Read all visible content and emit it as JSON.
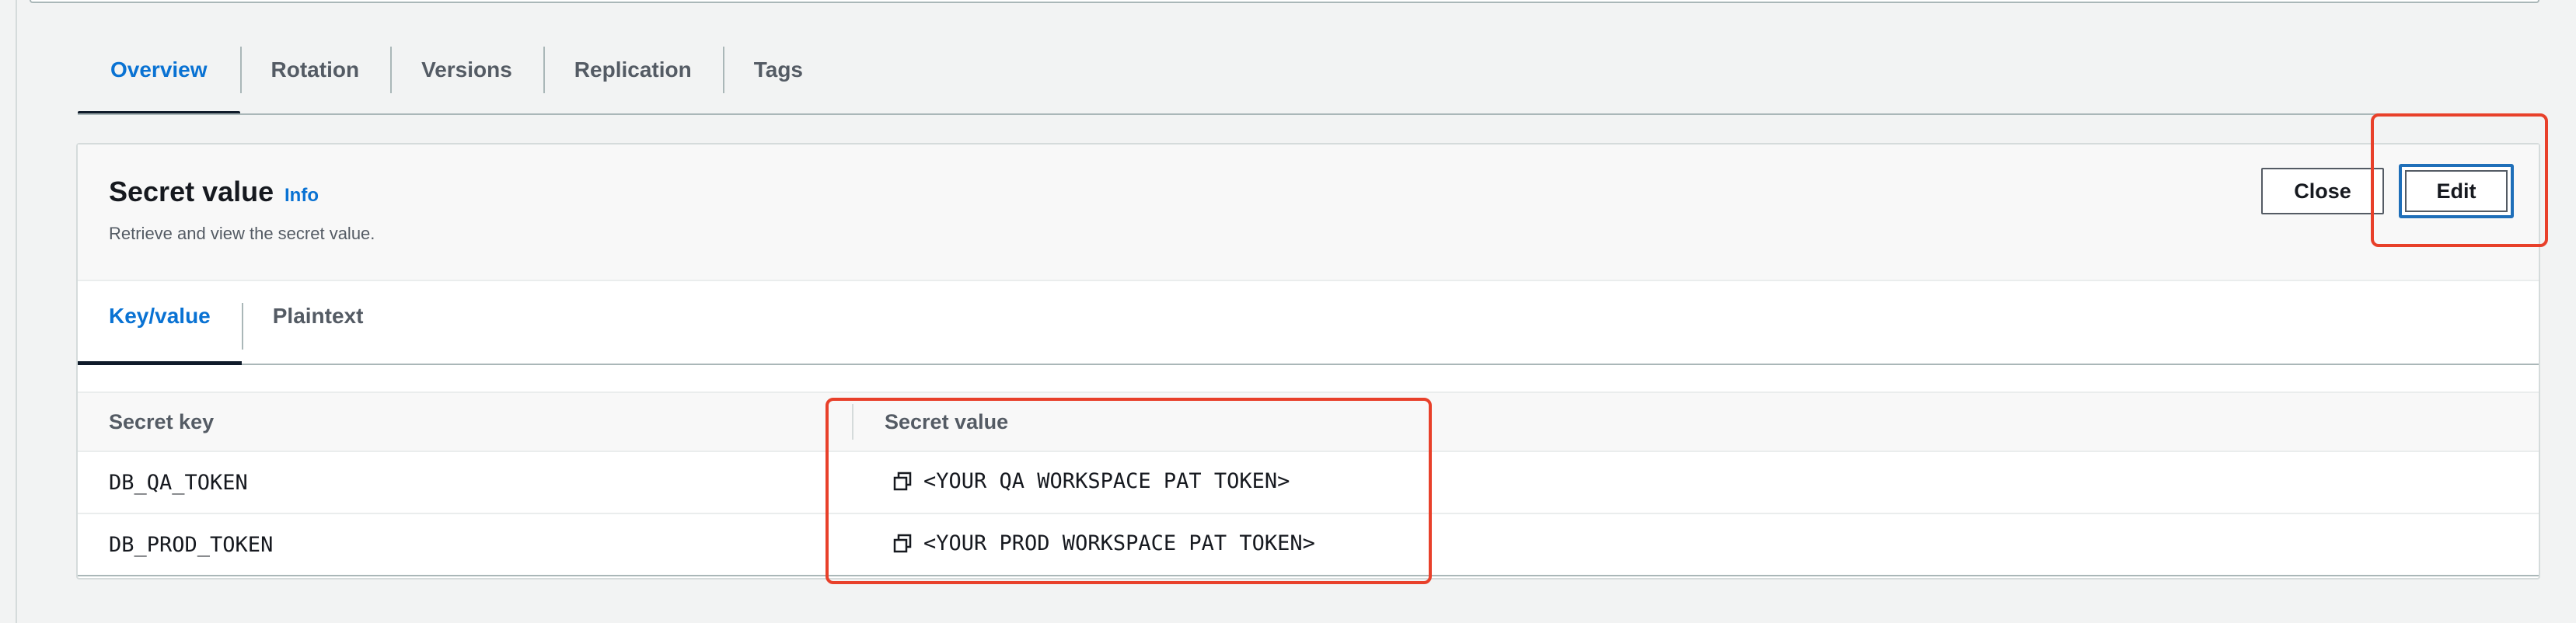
{
  "tabs": [
    {
      "label": "Overview",
      "active": true
    },
    {
      "label": "Rotation",
      "active": false
    },
    {
      "label": "Versions",
      "active": false
    },
    {
      "label": "Replication",
      "active": false
    },
    {
      "label": "Tags",
      "active": false
    }
  ],
  "secret_panel": {
    "title": "Secret value",
    "info_link": "Info",
    "description": "Retrieve and view the secret value.",
    "close_label": "Close",
    "edit_label": "Edit",
    "view_tabs": [
      {
        "label": "Key/value",
        "active": true
      },
      {
        "label": "Plaintext",
        "active": false
      }
    ],
    "table": {
      "headers": {
        "key": "Secret key",
        "value": "Secret value"
      },
      "rows": [
        {
          "key": "DB_QA_TOKEN",
          "value": "<YOUR QA WORKSPACE PAT TOKEN>"
        },
        {
          "key": "DB_PROD_TOKEN",
          "value": "<YOUR PROD WORKSPACE PAT TOKEN>"
        }
      ]
    }
  },
  "icons": {
    "copy": "copy-icon"
  },
  "colors": {
    "accent": "#0972d3",
    "annotation": "#e8402a",
    "edit_focus": "#1f6fb9",
    "page_bg": "#f2f3f3"
  }
}
